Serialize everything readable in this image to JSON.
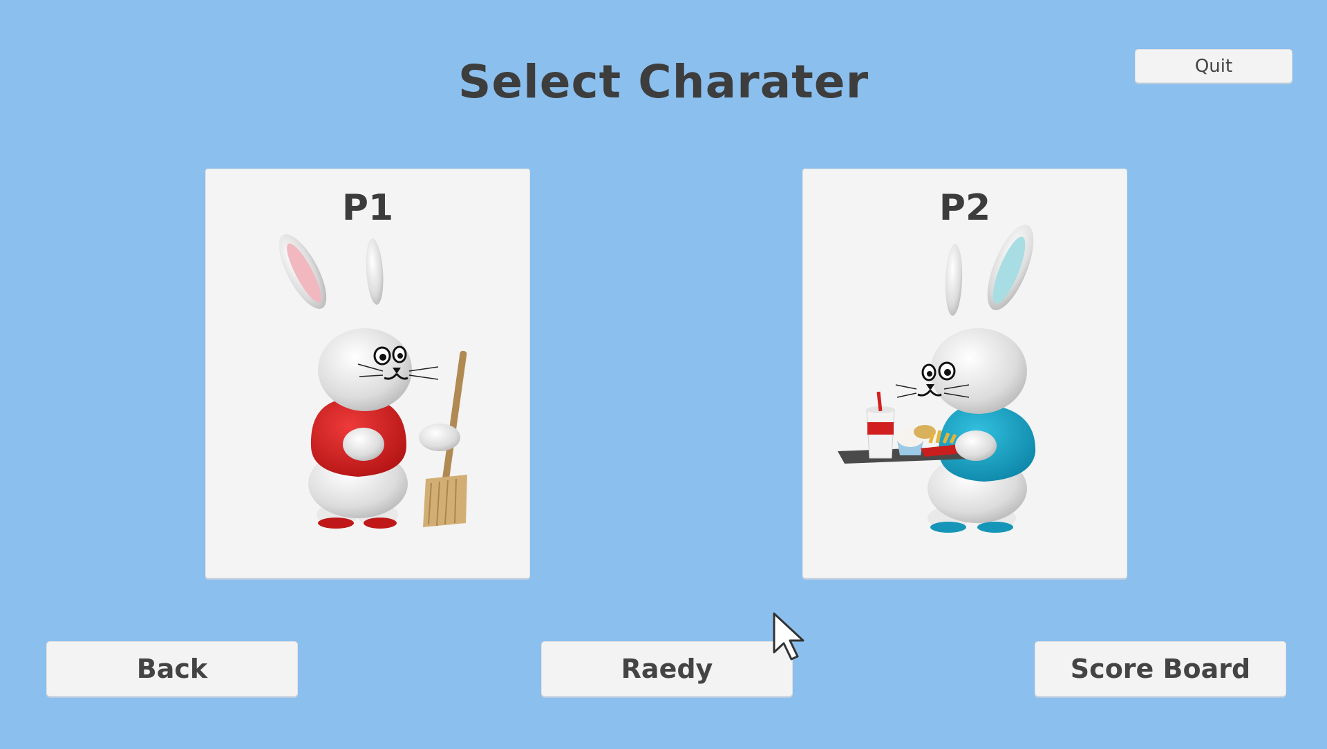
{
  "screen": {
    "title": "Select Charater"
  },
  "buttons": {
    "quit": "Quit",
    "back": "Back",
    "ready": "Raedy",
    "score_board": "Score Board"
  },
  "players": [
    {
      "label": "P1",
      "character": "bunny-with-broom",
      "shirt_color": "#d42222",
      "ear_color": "#f2b8c0"
    },
    {
      "label": "P2",
      "character": "bunny-with-food-tray",
      "shirt_color": "#1aa3c4",
      "ear_color": "#a9dde4"
    }
  ],
  "colors": {
    "background": "#8bbfee",
    "panel": "#f4f4f4",
    "text": "#3d3d3d"
  }
}
